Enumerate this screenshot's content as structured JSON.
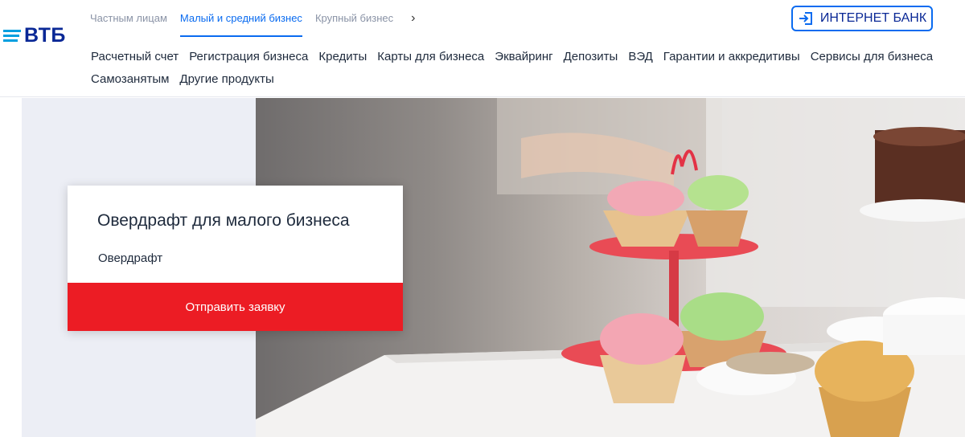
{
  "logo": {
    "text": "ВТБ"
  },
  "segments": [
    {
      "label": "Частным лицам",
      "active": false
    },
    {
      "label": "Малый и средний бизнес",
      "active": true
    },
    {
      "label": "Крупный бизнес",
      "active": false
    }
  ],
  "internet_bank": {
    "label": "ИНТЕРНЕТ БАНК"
  },
  "menu": {
    "row1": [
      "Расчетный счет",
      "Регистрация бизнеса",
      "Кредиты",
      "Карты для бизнеса",
      "Эквайринг",
      "Депозиты",
      "ВЭД",
      "Гарантии и аккредитивы",
      "Сервисы для бизнеса"
    ],
    "row2": [
      "Самозанятым",
      "Другие продукты"
    ]
  },
  "card": {
    "title": "Овердрафт для малого бизнеса",
    "subtitle": "Овердрафт",
    "button": "Отправить заявку"
  },
  "colors": {
    "brand_blue": "#0a2896",
    "accent_blue": "#0a6bf0",
    "cta_red": "#ec1c24"
  }
}
